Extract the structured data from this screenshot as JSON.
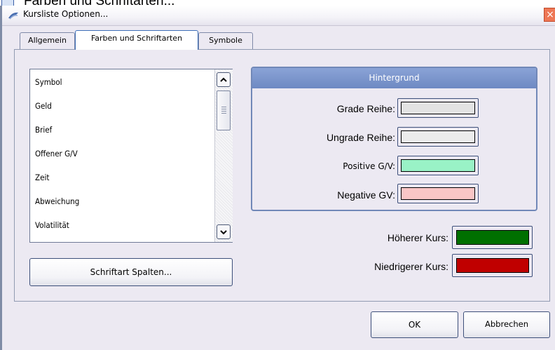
{
  "background_window": {
    "title": "Farben und Schriftarten..."
  },
  "window": {
    "title": "Kursliste Optionen...",
    "close_glyph": "×"
  },
  "tabs": [
    {
      "label": "Allgemein",
      "active": false
    },
    {
      "label": "Farben und Schriftarten",
      "active": true
    },
    {
      "label": "Symbole",
      "active": false
    }
  ],
  "column_list": {
    "items": [
      "Symbol",
      "Geld",
      "Brief",
      "Offener G/V",
      "Zeit",
      "Abweichung",
      "Volatilität"
    ]
  },
  "font_button": {
    "label": "Schriftart Spalten..."
  },
  "background_group": {
    "title": "Hintergrund",
    "rows": [
      {
        "label": "Grade Reihe:",
        "color": "#e3e3e3"
      },
      {
        "label": "Ungrade Reihe:",
        "color": "#ececec"
      },
      {
        "label": "Positive G/V:",
        "color": "#99f2c6"
      },
      {
        "label": "Negative GV:",
        "color": "#f9c6c6"
      }
    ]
  },
  "price_colors": [
    {
      "label": "Höherer Kurs:",
      "color": "#007000"
    },
    {
      "label": "Niedrigerer Kurs:",
      "color": "#c00000"
    }
  ],
  "footer": {
    "ok_label": "OK",
    "cancel_label": "Abbrechen"
  },
  "colors": {
    "group_header": "#7c96cd",
    "window_bg": "#ece9f2",
    "close_button": "#ee7755"
  }
}
